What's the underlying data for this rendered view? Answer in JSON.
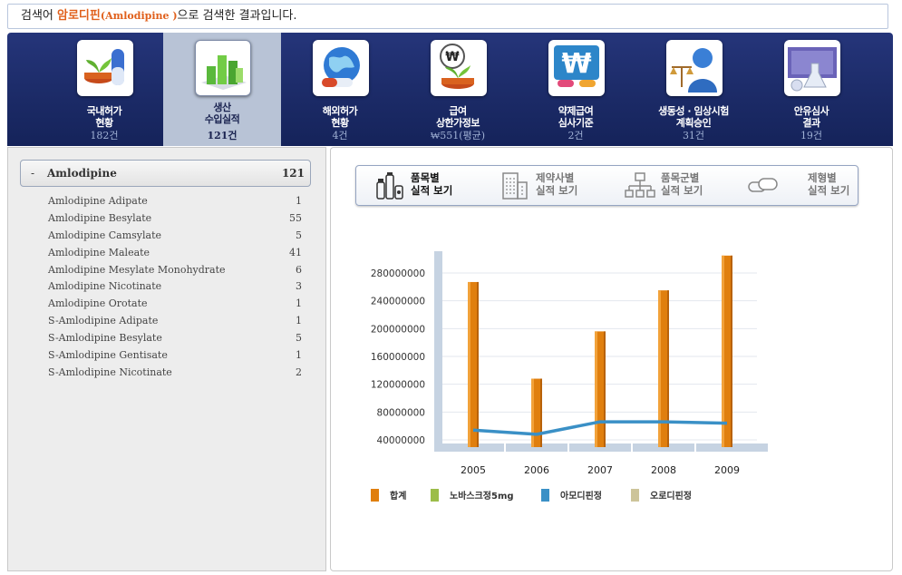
{
  "search": {
    "prefix": "검색어 ",
    "keyword_ko": "암로디핀",
    "keyword_en": "(Amlodipine )",
    "suffix": "으로 검색한 결과입니다."
  },
  "nav": [
    {
      "line1": "국내허가",
      "line2": "현황",
      "count": "182건",
      "icon": "domestic-approval-icon"
    },
    {
      "line1": "생산",
      "line2": "수입실적",
      "count": "121건",
      "icon": "production-chart-icon",
      "active": true
    },
    {
      "line1": "해외허가",
      "line2": "현황",
      "count": "4건",
      "icon": "globe-icon"
    },
    {
      "line1": "급여",
      "line2": "상한가정보",
      "count": "₩551(평균)",
      "icon": "won-price-icon"
    },
    {
      "line1": "약제급여",
      "line2": "심사기준",
      "count": "2건",
      "icon": "won-pills-icon"
    },
    {
      "line1": "생동성 · 임상시험",
      "line2": "계획승인",
      "count": "31건",
      "icon": "scale-person-icon"
    },
    {
      "line1": "안유심사",
      "line2": "결과",
      "count": "19건",
      "icon": "lab-flask-icon"
    }
  ],
  "tree": {
    "toggle": "-",
    "name": "Amlodipine",
    "count": "121",
    "items": [
      {
        "name": "Amlodipine Adipate",
        "count": "1"
      },
      {
        "name": "Amlodipine Besylate",
        "count": "55"
      },
      {
        "name": "Amlodipine Camsylate",
        "count": "5"
      },
      {
        "name": "Amlodipine Maleate",
        "count": "41"
      },
      {
        "name": "Amlodipine Mesylate Monohydrate",
        "count": "6"
      },
      {
        "name": "Amlodipine Nicotinate",
        "count": "3"
      },
      {
        "name": "Amlodipine Orotate",
        "count": "1"
      },
      {
        "name": "S-Amlodipine Adipate",
        "count": "1"
      },
      {
        "name": "S-Amlodipine Besylate",
        "count": "5"
      },
      {
        "name": "S-Amlodipine Gentisate",
        "count": "1"
      },
      {
        "name": "S-Amlodipine Nicotinate",
        "count": "2"
      }
    ]
  },
  "tabs": [
    {
      "line1": "품목별",
      "line2": "실적 보기",
      "icon": "pill-bottles-icon",
      "active": true
    },
    {
      "line1": "제약사별",
      "line2": "실적 보기",
      "icon": "building-icon"
    },
    {
      "line1": "품목군별",
      "line2": "실적 보기",
      "icon": "hierarchy-icon"
    },
    {
      "line1": "제형별",
      "line2": "실적 보기",
      "icon": "capsule-icon"
    }
  ],
  "chart_data": {
    "type": "bar",
    "categories": [
      "2005",
      "2006",
      "2007",
      "2008",
      "2009"
    ],
    "yticks": [
      "40000000",
      "80000000",
      "120000000",
      "160000000",
      "200000000",
      "240000000",
      "280000000"
    ],
    "ylim": [
      0,
      300000000
    ],
    "series": [
      {
        "name": "합계",
        "kind": "bar",
        "color": "#e07f0e",
        "values": [
          267000000,
          128000000,
          196000000,
          255000000,
          305000000
        ]
      },
      {
        "name": "노바스크정5mg",
        "kind": "line",
        "color": "#9cbd49",
        "values": []
      },
      {
        "name": "아모디핀정",
        "kind": "line",
        "color": "#3a90c6",
        "values": [
          54000000,
          48000000,
          66000000,
          66000000,
          64000000
        ]
      },
      {
        "name": "오로디핀정",
        "kind": "line",
        "color": "#cdc49a",
        "values": []
      }
    ]
  }
}
